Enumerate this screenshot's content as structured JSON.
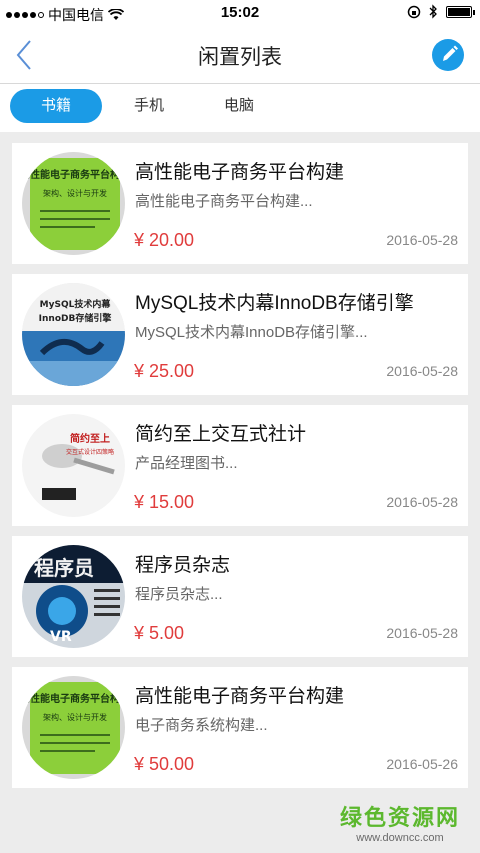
{
  "status_bar": {
    "carrier": "中国电信",
    "time": "15:02"
  },
  "nav": {
    "title": "闲置列表"
  },
  "tabs": [
    {
      "label": "书籍",
      "active": true
    },
    {
      "label": "手机",
      "active": false
    },
    {
      "label": "电脑",
      "active": false
    }
  ],
  "items": [
    {
      "title": "高性能电子商务平台构建",
      "desc": "高性能电子商务平台构建...",
      "price": "¥ 20.00",
      "date": "2016-05-28",
      "cover_text": "高性能电子商务平台构建",
      "cover_sub": "架构、设计与开发"
    },
    {
      "title": "MySQL技术内幕InnoDB存储引擎",
      "desc": "MySQL技术内幕InnoDB存储引擎...",
      "price": "¥ 25.00",
      "date": "2016-05-28",
      "cover_text": "MySQL技术内幕",
      "cover_sub": "InnoDB存储引擎"
    },
    {
      "title": "简约至上交互式社计",
      "desc": "产品经理图书...",
      "price": "¥ 15.00",
      "date": "2016-05-28",
      "cover_text": "简约至上",
      "cover_sub": "交互式设计四策略"
    },
    {
      "title": "程序员杂志",
      "desc": "程序员杂志...",
      "price": "¥ 5.00",
      "date": "2016-05-28",
      "cover_text": "程序员",
      "cover_sub": "VR"
    },
    {
      "title": "高性能电子商务平台构建",
      "desc": "电子商务系统构建...",
      "price": "¥ 50.00",
      "date": "2016-05-26",
      "cover_text": "高性能电子商务平台构建",
      "cover_sub": "架构、设计与开发"
    }
  ],
  "watermark": {
    "title": "绿色资源网",
    "url": "www.downcc.com"
  },
  "colors": {
    "accent": "#1b9be6",
    "price": "#e03c3c",
    "watermark": "#5cb82e"
  }
}
